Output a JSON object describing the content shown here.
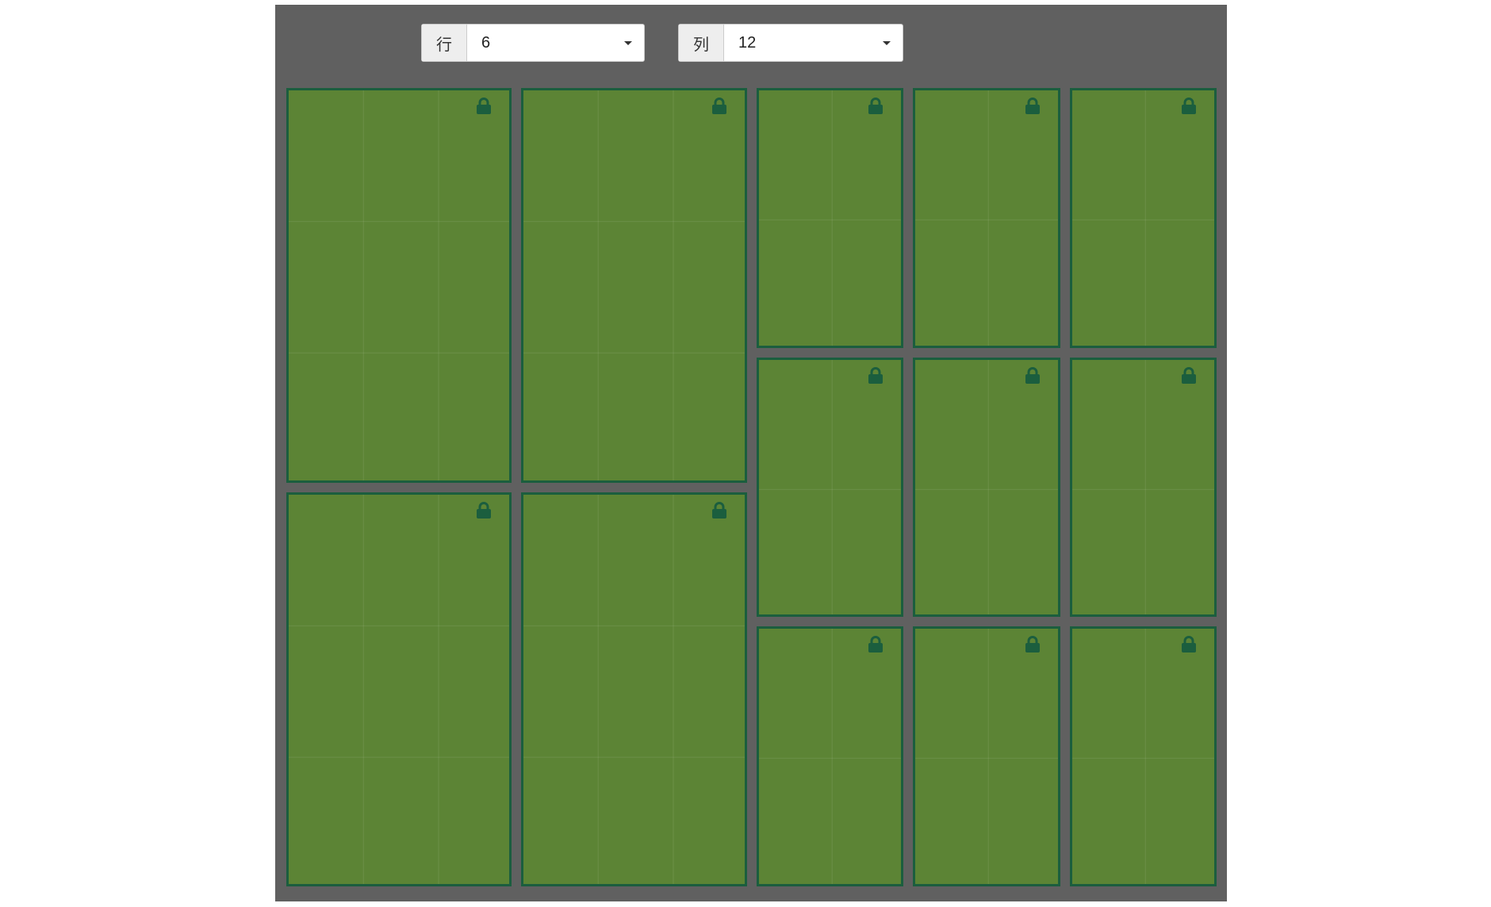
{
  "toolbar": {
    "rows": {
      "label": "行",
      "value": "6"
    },
    "cols": {
      "label": "列",
      "value": "12"
    }
  },
  "grid": {
    "rows": 6,
    "cols": 12,
    "cell_color": "#5c8435",
    "border_color": "#1b5e3e",
    "icon": "lock-icon",
    "panes": [
      {
        "row": 0,
        "col": 0,
        "rowspan": 3,
        "colspan": 3
      },
      {
        "row": 0,
        "col": 3,
        "rowspan": 3,
        "colspan": 3
      },
      {
        "row": 0,
        "col": 6,
        "rowspan": 2,
        "colspan": 2
      },
      {
        "row": 0,
        "col": 8,
        "rowspan": 2,
        "colspan": 2
      },
      {
        "row": 0,
        "col": 10,
        "rowspan": 2,
        "colspan": 2
      },
      {
        "row": 2,
        "col": 6,
        "rowspan": 2,
        "colspan": 2
      },
      {
        "row": 2,
        "col": 8,
        "rowspan": 2,
        "colspan": 2
      },
      {
        "row": 2,
        "col": 10,
        "rowspan": 2,
        "colspan": 2
      },
      {
        "row": 3,
        "col": 0,
        "rowspan": 3,
        "colspan": 3
      },
      {
        "row": 3,
        "col": 3,
        "rowspan": 3,
        "colspan": 3
      },
      {
        "row": 4,
        "col": 6,
        "rowspan": 2,
        "colspan": 2
      },
      {
        "row": 4,
        "col": 8,
        "rowspan": 2,
        "colspan": 2
      },
      {
        "row": 4,
        "col": 10,
        "rowspan": 2,
        "colspan": 2
      }
    ]
  }
}
